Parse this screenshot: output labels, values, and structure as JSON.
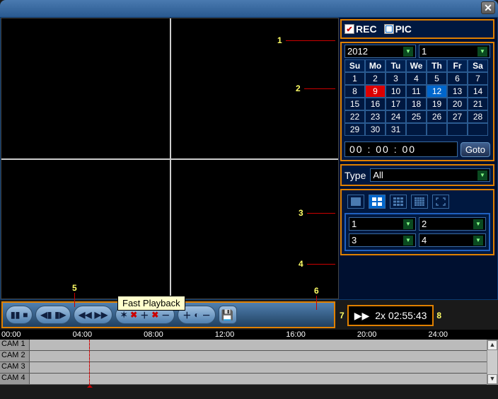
{
  "titlebar": {
    "close": "✕"
  },
  "recpic": {
    "rec_label": "REC",
    "rec_checked": true,
    "pic_label": "PIC",
    "pic_checked": false
  },
  "date": {
    "year": "2012",
    "month": "1",
    "weekdays": [
      "Su",
      "Mo",
      "Tu",
      "We",
      "Th",
      "Fr",
      "Sa"
    ],
    "days": [
      [
        "1",
        "2",
        "3",
        "4",
        "5",
        "6",
        "7"
      ],
      [
        "8",
        "9",
        "10",
        "11",
        "12",
        "13",
        "14"
      ],
      [
        "15",
        "16",
        "17",
        "18",
        "19",
        "20",
        "21"
      ],
      [
        "22",
        "23",
        "24",
        "25",
        "26",
        "27",
        "28"
      ],
      [
        "29",
        "30",
        "31",
        "",
        "",
        "",
        ""
      ]
    ],
    "selected": "9",
    "today": "12"
  },
  "time": {
    "display": "00 : 00 : 00",
    "goto": "Goto"
  },
  "type": {
    "label": "Type",
    "value": "All"
  },
  "channels": {
    "c1": "1",
    "c2": "2",
    "c3": "3",
    "c4": "4"
  },
  "tooltip": "Fast Playback",
  "status": {
    "icon": "▶▶",
    "text": "2x 02:55:43"
  },
  "timeline": {
    "ticks": [
      "00:00",
      "04:00",
      "08:00",
      "12:00",
      "16:00",
      "20:00",
      "24:00"
    ],
    "cams": [
      "CAM 1",
      "CAM 2",
      "CAM 3",
      "CAM 4"
    ]
  },
  "annotations": {
    "n1": "1",
    "n2": "2",
    "n3": "3",
    "n4": "4",
    "n5": "5",
    "n6": "6",
    "n7": "7",
    "n8": "8"
  }
}
